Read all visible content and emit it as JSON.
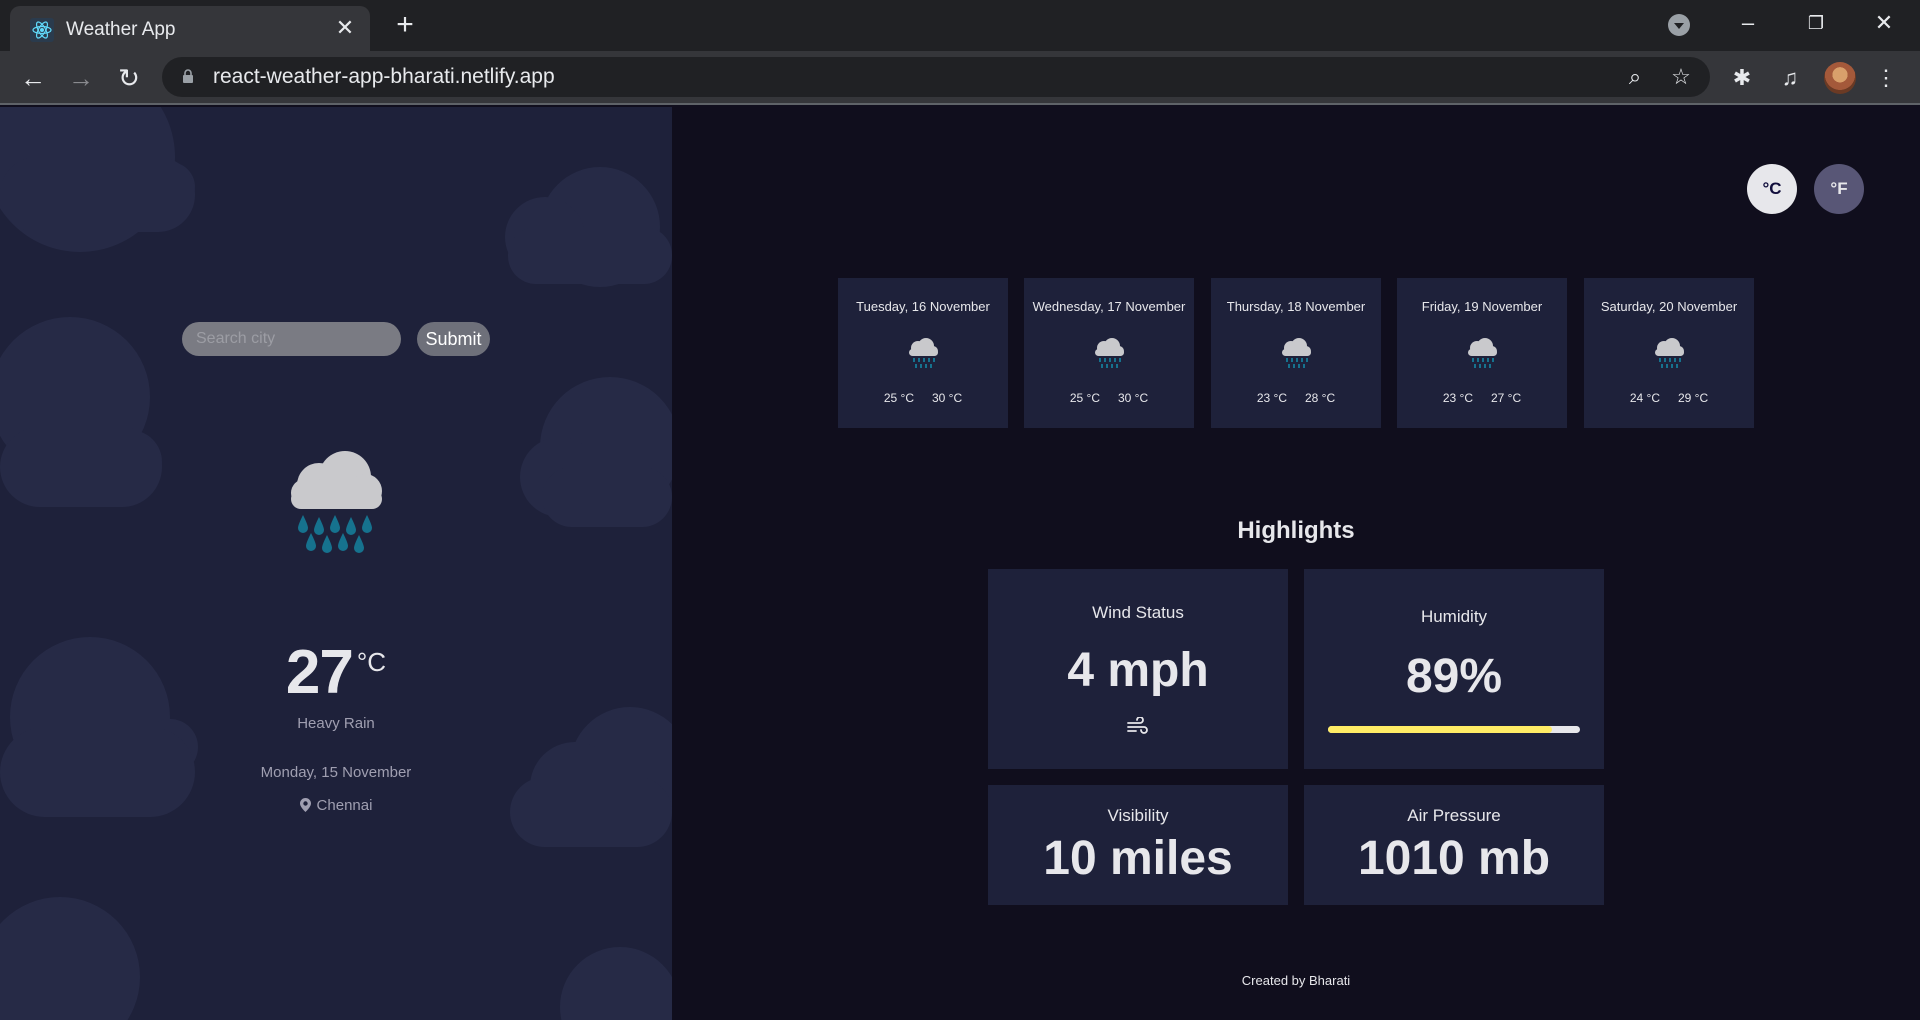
{
  "browser": {
    "tab_title": "Weather App",
    "url": "react-weather-app-bharati.netlify.app",
    "icons": [
      "react-favicon-icon",
      "close-icon",
      "plus-icon",
      "back-icon",
      "forward-icon",
      "reload-icon",
      "lock-icon",
      "zoom-icon",
      "star-icon",
      "extensions-icon",
      "media-icon",
      "menu-icon"
    ]
  },
  "search": {
    "placeholder": "Search city",
    "submit_label": "Submit"
  },
  "current": {
    "temp": "27",
    "unit": "°C",
    "condition": "Heavy Rain",
    "date": "Monday, 15 November",
    "location": "Chennai"
  },
  "units": {
    "celsius": "°C",
    "fahrenheit": "°F"
  },
  "forecast": [
    {
      "day": "Tuesday, 16 November",
      "min": "25 °C",
      "max": "30 °C"
    },
    {
      "day": "Wednesday, 17 November",
      "min": "25 °C",
      "max": "30 °C"
    },
    {
      "day": "Thursday, 18 November",
      "min": "23 °C",
      "max": "28 °C"
    },
    {
      "day": "Friday, 19 November",
      "min": "23 °C",
      "max": "27 °C"
    },
    {
      "day": "Saturday, 20 November",
      "min": "24 °C",
      "max": "29 °C"
    }
  ],
  "highlights": {
    "title": "Highlights",
    "wind": {
      "label": "Wind Status",
      "value": "4 mph"
    },
    "humidity": {
      "label": "Humidity",
      "value": "89%",
      "percent": 89
    },
    "visibility": {
      "label": "Visibility",
      "value": "10 miles"
    },
    "pressure": {
      "label": "Air Pressure",
      "value": "1010 mb"
    }
  },
  "footer": "Created by Bharati",
  "colors": {
    "sidebar_bg": "#1e213a",
    "main_bg": "#100e1d",
    "humidity_bar": "#ffec65",
    "text": "#e7e7eb",
    "muted_text": "#a09fb1"
  }
}
